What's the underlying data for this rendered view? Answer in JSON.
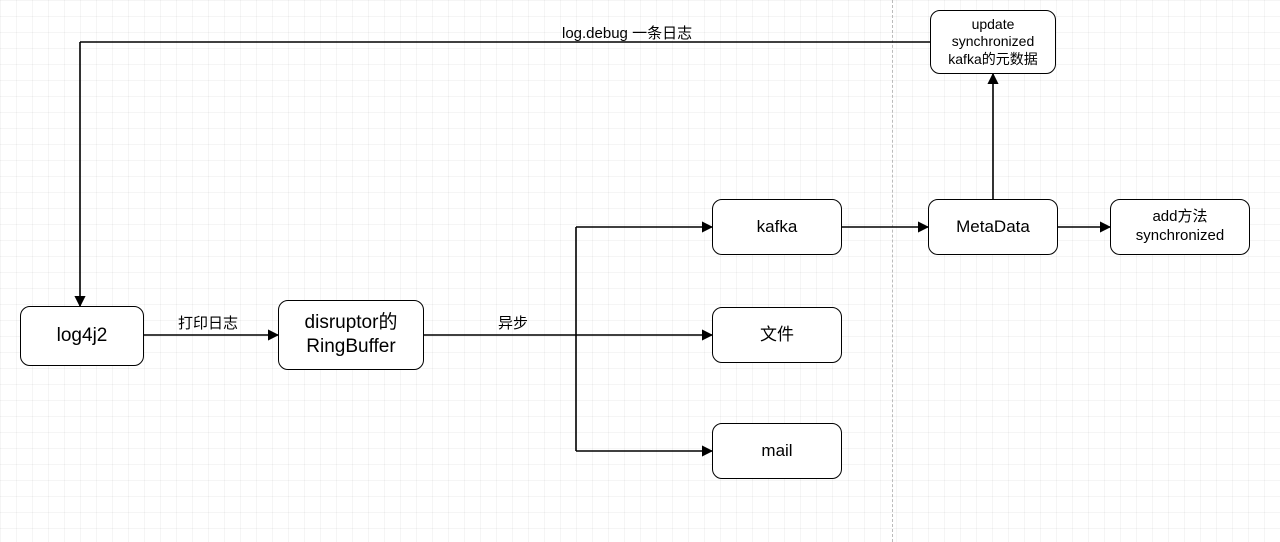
{
  "nodes": {
    "log4j2": "log4j2",
    "ringbuffer": "disruptor的\nRingBuffer",
    "kafka": "kafka",
    "file": "文件",
    "mail": "mail",
    "metadata": "MetaData",
    "update": "update\nsynchronized\nkafka的元数据",
    "add": "add方法\nsynchronized"
  },
  "edges": {
    "log_to_ring": "打印日志",
    "ring_to_targets": "异步",
    "log_debug": "log.debug 一条日志"
  }
}
